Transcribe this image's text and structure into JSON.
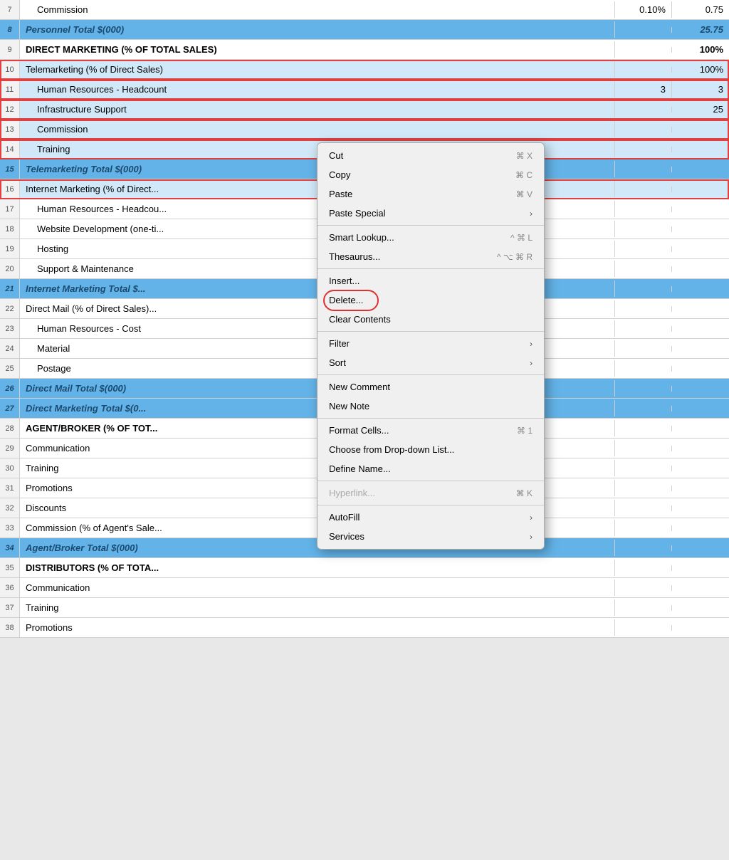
{
  "rows": [
    {
      "num": "7",
      "main": "Commission",
      "val1": "0.10%",
      "val2": "0.75",
      "type": "normal",
      "indented": true
    },
    {
      "num": "8",
      "main": "Personnel Total $(000)",
      "val1": "",
      "val2": "25.75",
      "type": "blue"
    },
    {
      "num": "9",
      "main": "DIRECT MARKETING (% OF TOTAL SALES)",
      "val1": "",
      "val2": "100%",
      "type": "bold"
    },
    {
      "num": "10",
      "main": "Telemarketing (% of Direct Sales)",
      "val1": "",
      "val2": "100%",
      "type": "selected-outline",
      "indented": false
    },
    {
      "num": "11",
      "main": "Human Resources - Headcount",
      "val1": "3",
      "val2": "3",
      "type": "selected-outline",
      "indented": true
    },
    {
      "num": "12",
      "main": "Infrastructure Support",
      "val1": "",
      "val2": "25",
      "type": "selected-outline",
      "indented": true
    },
    {
      "num": "13",
      "main": "Commission",
      "val1": "",
      "val2": "",
      "type": "selected-outline",
      "indented": true
    },
    {
      "num": "14",
      "main": "Training",
      "val1": "",
      "val2": "",
      "type": "selected-outline",
      "indented": true
    },
    {
      "num": "15",
      "main": "Telemarketing Total $(000)",
      "val1": "",
      "val2": "",
      "type": "blue"
    },
    {
      "num": "16",
      "main": "Internet Marketing (% of Direct...",
      "val1": "",
      "val2": "",
      "type": "selected-outline"
    },
    {
      "num": "17",
      "main": "Human Resources - Headcou...",
      "val1": "",
      "val2": "",
      "type": "normal",
      "indented": true
    },
    {
      "num": "18",
      "main": "Website Development (one-ti...",
      "val1": "",
      "val2": "",
      "type": "normal",
      "indented": true
    },
    {
      "num": "19",
      "main": "Hosting",
      "val1": "",
      "val2": "",
      "type": "normal",
      "indented": true
    },
    {
      "num": "20",
      "main": "Support & Maintenance",
      "val1": "",
      "val2": "",
      "type": "normal",
      "indented": true
    },
    {
      "num": "21",
      "main": "Internet Marketing Total $...",
      "val1": "",
      "val2": "",
      "type": "blue"
    },
    {
      "num": "22",
      "main": "Direct Mail (% of Direct Sales)...",
      "val1": "",
      "val2": "",
      "type": "normal"
    },
    {
      "num": "23",
      "main": "Human Resources - Cost",
      "val1": "",
      "val2": "",
      "type": "normal",
      "indented": true
    },
    {
      "num": "24",
      "main": "Material",
      "val1": "",
      "val2": "",
      "type": "normal",
      "indented": true
    },
    {
      "num": "25",
      "main": "Postage",
      "val1": "",
      "val2": "",
      "type": "normal",
      "indented": true
    },
    {
      "num": "26",
      "main": "Direct Mail Total $(000)",
      "val1": "",
      "val2": "",
      "type": "blue"
    },
    {
      "num": "27",
      "main": "Direct Marketing Total $(0...",
      "val1": "",
      "val2": "",
      "type": "blue"
    },
    {
      "num": "28",
      "main": "AGENT/BROKER (% OF TOT...",
      "val1": "",
      "val2": "",
      "type": "bold"
    },
    {
      "num": "29",
      "main": "Communication",
      "val1": "",
      "val2": "",
      "type": "normal",
      "indented": false
    },
    {
      "num": "30",
      "main": "Training",
      "val1": "",
      "val2": "",
      "type": "normal",
      "indented": false
    },
    {
      "num": "31",
      "main": "Promotions",
      "val1": "",
      "val2": "",
      "type": "normal",
      "indented": false
    },
    {
      "num": "32",
      "main": "Discounts",
      "val1": "",
      "val2": "",
      "type": "normal",
      "indented": false
    },
    {
      "num": "33",
      "main": "Commission (% of Agent's Sale...",
      "val1": "",
      "val2": "",
      "type": "normal",
      "indented": false
    },
    {
      "num": "34",
      "main": "Agent/Broker Total $(000)",
      "val1": "",
      "val2": "",
      "type": "blue"
    },
    {
      "num": "35",
      "main": "DISTRIBUTORS (% OF TOTA...",
      "val1": "",
      "val2": "",
      "type": "bold"
    },
    {
      "num": "36",
      "main": "Communication",
      "val1": "",
      "val2": "",
      "type": "normal",
      "indented": false
    },
    {
      "num": "37",
      "main": "Training",
      "val1": "",
      "val2": "",
      "type": "normal",
      "indented": false
    },
    {
      "num": "38",
      "main": "Promotions",
      "val1": "",
      "val2": "",
      "type": "normal",
      "indented": false
    }
  ],
  "contextMenu": {
    "items": [
      {
        "label": "Cut",
        "shortcut": "⌘ X",
        "type": "normal",
        "arrow": false
      },
      {
        "label": "Copy",
        "shortcut": "⌘ C",
        "type": "normal",
        "arrow": false
      },
      {
        "label": "Paste",
        "shortcut": "⌘ V",
        "type": "normal",
        "arrow": false
      },
      {
        "label": "Paste Special",
        "shortcut": "",
        "type": "normal",
        "arrow": true
      },
      {
        "label": "sep1",
        "type": "separator"
      },
      {
        "label": "Smart Lookup...",
        "shortcut": "^ ⌘ L",
        "type": "normal",
        "arrow": false
      },
      {
        "label": "Thesaurus...",
        "shortcut": "^ ⌥ ⌘ R",
        "type": "normal",
        "arrow": false
      },
      {
        "label": "sep2",
        "type": "separator"
      },
      {
        "label": "Insert...",
        "shortcut": "",
        "type": "normal",
        "arrow": false
      },
      {
        "label": "Delete...",
        "shortcut": "",
        "type": "delete",
        "arrow": false
      },
      {
        "label": "Clear Contents",
        "shortcut": "",
        "type": "normal",
        "arrow": false
      },
      {
        "label": "sep3",
        "type": "separator"
      },
      {
        "label": "Filter",
        "shortcut": "",
        "type": "normal",
        "arrow": true
      },
      {
        "label": "Sort",
        "shortcut": "",
        "type": "normal",
        "arrow": true
      },
      {
        "label": "sep4",
        "type": "separator"
      },
      {
        "label": "New Comment",
        "shortcut": "",
        "type": "normal",
        "arrow": false
      },
      {
        "label": "New Note",
        "shortcut": "",
        "type": "normal",
        "arrow": false
      },
      {
        "label": "sep5",
        "type": "separator"
      },
      {
        "label": "Format Cells...",
        "shortcut": "⌘ 1",
        "type": "normal",
        "arrow": false
      },
      {
        "label": "Choose from Drop-down List...",
        "shortcut": "",
        "type": "normal",
        "arrow": false
      },
      {
        "label": "Define Name...",
        "shortcut": "",
        "type": "normal",
        "arrow": false
      },
      {
        "label": "sep6",
        "type": "separator"
      },
      {
        "label": "Hyperlink...",
        "shortcut": "⌘ K",
        "type": "disabled",
        "arrow": false
      },
      {
        "label": "sep7",
        "type": "separator"
      },
      {
        "label": "AutoFill",
        "shortcut": "",
        "type": "normal",
        "arrow": true
      },
      {
        "label": "Services",
        "shortcut": "",
        "type": "normal",
        "arrow": true
      }
    ]
  }
}
